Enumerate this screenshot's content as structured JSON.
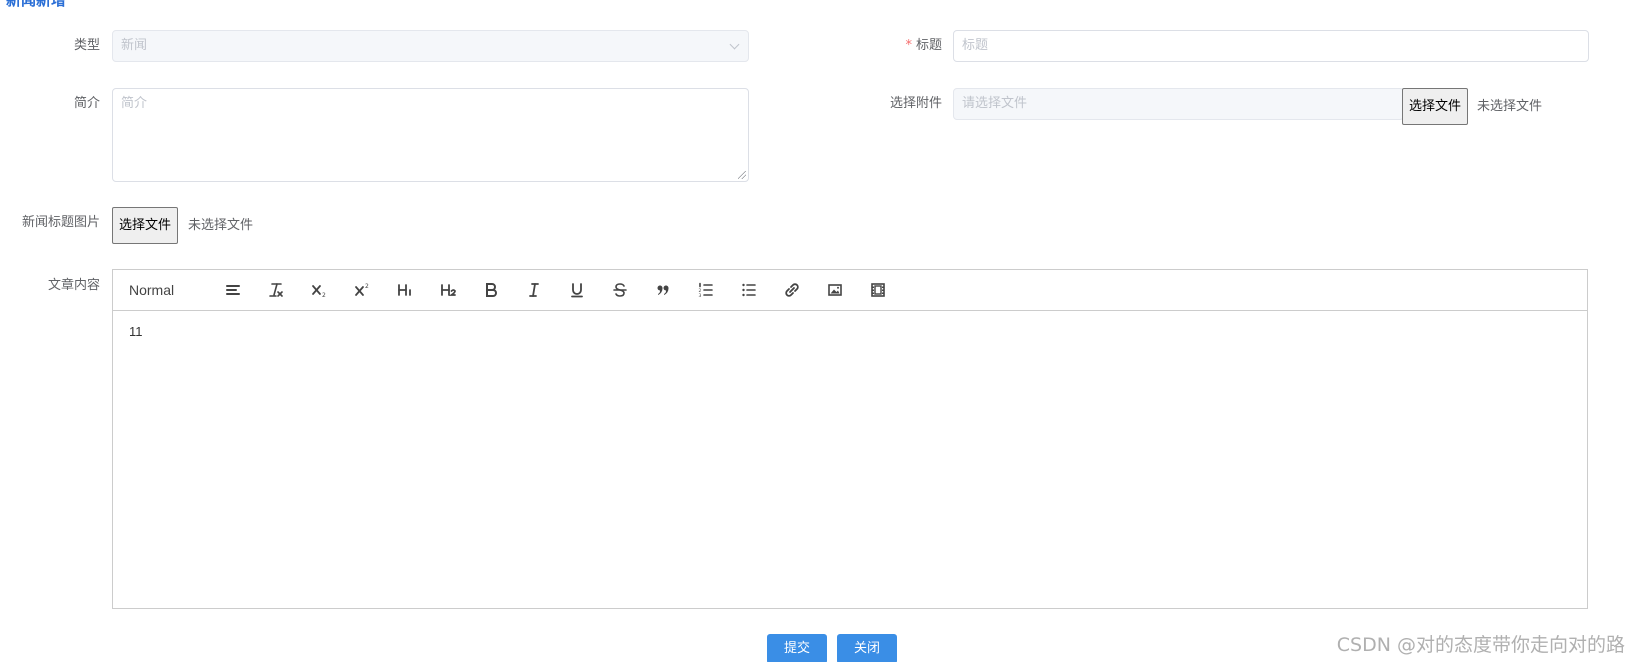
{
  "page": {
    "heading": "新闻新增"
  },
  "form": {
    "type": {
      "label": "类型",
      "value": "新闻"
    },
    "title": {
      "label": "标题",
      "required_mark": "*",
      "placeholder": "标题"
    },
    "summary": {
      "label": "简介",
      "placeholder": "简介"
    },
    "attachment": {
      "label": "选择附件",
      "placeholder": "请选择文件",
      "button_label": "选择文件",
      "status": "未选择文件"
    },
    "cover_image": {
      "label": "新闻标题图片",
      "button_label": "选择文件",
      "status": "未选择文件"
    },
    "article": {
      "label": "文章内容",
      "toolbar": {
        "header_select": "Normal",
        "icons": [
          "align-icon",
          "clear-format-icon",
          "subscript-icon",
          "superscript-icon",
          "header-1-icon",
          "header-2-icon",
          "bold-icon",
          "italic-icon",
          "underline-icon",
          "strikethrough-icon",
          "blockquote-icon",
          "ordered-list-icon",
          "bullet-list-icon",
          "link-icon",
          "image-icon",
          "video-icon"
        ]
      },
      "content": "11"
    }
  },
  "actions": {
    "submit": "提交",
    "close": "关闭"
  },
  "watermark": "CSDN @对的态度带你走向对的路",
  "colors": {
    "primary": "#3a8ee6",
    "heading": "#2b6fd6",
    "required": "#f56c6c"
  }
}
